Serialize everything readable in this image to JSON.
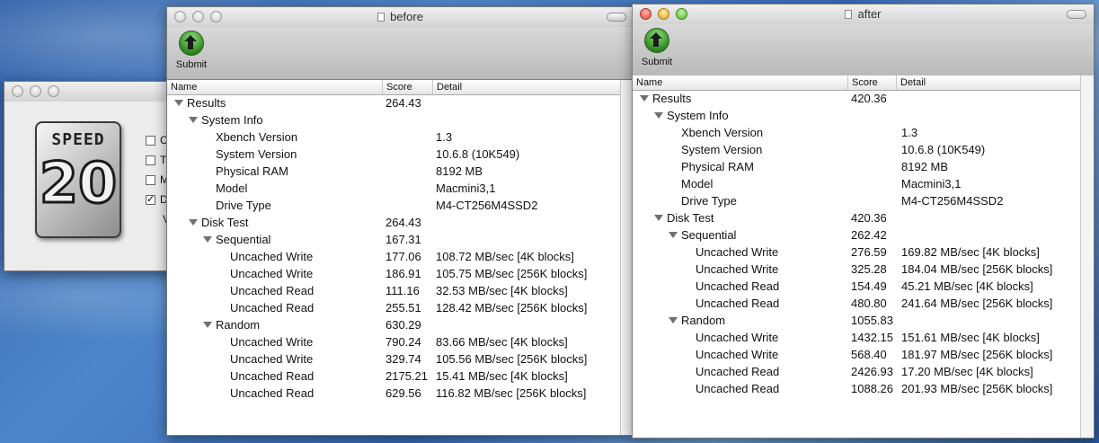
{
  "speed_window": {
    "badge_top": "SPEED",
    "badge_number": "20",
    "checkboxes": [
      {
        "label": "C",
        "checked": false
      },
      {
        "label": "T",
        "checked": false
      },
      {
        "label": "M",
        "checked": false
      },
      {
        "label": "D",
        "checked": true
      }
    ],
    "trailing_label": "V"
  },
  "before_window": {
    "title": "before",
    "submit_label": "Submit",
    "columns": [
      "Name",
      "Score",
      "Detail"
    ],
    "rows": [
      {
        "indent": 0,
        "disclosure": true,
        "name": "Results",
        "score": "264.43",
        "detail": ""
      },
      {
        "indent": 1,
        "disclosure": true,
        "name": "System Info",
        "score": "",
        "detail": ""
      },
      {
        "indent": 2,
        "disclosure": false,
        "name": "Xbench Version",
        "score": "",
        "detail": "1.3"
      },
      {
        "indent": 2,
        "disclosure": false,
        "name": "System Version",
        "score": "",
        "detail": "10.6.8 (10K549)"
      },
      {
        "indent": 2,
        "disclosure": false,
        "name": "Physical RAM",
        "score": "",
        "detail": "8192 MB"
      },
      {
        "indent": 2,
        "disclosure": false,
        "name": "Model",
        "score": "",
        "detail": "Macmini3,1"
      },
      {
        "indent": 2,
        "disclosure": false,
        "name": "Drive Type",
        "score": "",
        "detail": "M4-CT256M4SSD2"
      },
      {
        "indent": 1,
        "disclosure": true,
        "name": "Disk Test",
        "score": "264.43",
        "detail": ""
      },
      {
        "indent": 2,
        "disclosure": true,
        "name": "Sequential",
        "score": "167.31",
        "detail": ""
      },
      {
        "indent": 3,
        "disclosure": false,
        "name": "Uncached Write",
        "score": "177.06",
        "detail": "108.72 MB/sec [4K blocks]"
      },
      {
        "indent": 3,
        "disclosure": false,
        "name": "Uncached Write",
        "score": "186.91",
        "detail": "105.75 MB/sec [256K blocks]"
      },
      {
        "indent": 3,
        "disclosure": false,
        "name": "Uncached Read",
        "score": "111.16",
        "detail": "32.53 MB/sec [4K blocks]"
      },
      {
        "indent": 3,
        "disclosure": false,
        "name": "Uncached Read",
        "score": "255.51",
        "detail": "128.42 MB/sec [256K blocks]"
      },
      {
        "indent": 2,
        "disclosure": true,
        "name": "Random",
        "score": "630.29",
        "detail": ""
      },
      {
        "indent": 3,
        "disclosure": false,
        "name": "Uncached Write",
        "score": "790.24",
        "detail": "83.66 MB/sec [4K blocks]"
      },
      {
        "indent": 3,
        "disclosure": false,
        "name": "Uncached Write",
        "score": "329.74",
        "detail": "105.56 MB/sec [256K blocks]"
      },
      {
        "indent": 3,
        "disclosure": false,
        "name": "Uncached Read",
        "score": "2175.21",
        "detail": "15.41 MB/sec [4K blocks]"
      },
      {
        "indent": 3,
        "disclosure": false,
        "name": "Uncached Read",
        "score": "629.56",
        "detail": "116.82 MB/sec [256K blocks]"
      }
    ]
  },
  "after_window": {
    "title": "after",
    "submit_label": "Submit",
    "columns": [
      "Name",
      "Score",
      "Detail"
    ],
    "rows": [
      {
        "indent": 0,
        "disclosure": true,
        "name": "Results",
        "score": "420.36",
        "detail": ""
      },
      {
        "indent": 1,
        "disclosure": true,
        "name": "System Info",
        "score": "",
        "detail": ""
      },
      {
        "indent": 2,
        "disclosure": false,
        "name": "Xbench Version",
        "score": "",
        "detail": "1.3"
      },
      {
        "indent": 2,
        "disclosure": false,
        "name": "System Version",
        "score": "",
        "detail": "10.6.8 (10K549)"
      },
      {
        "indent": 2,
        "disclosure": false,
        "name": "Physical RAM",
        "score": "",
        "detail": "8192 MB"
      },
      {
        "indent": 2,
        "disclosure": false,
        "name": "Model",
        "score": "",
        "detail": "Macmini3,1"
      },
      {
        "indent": 2,
        "disclosure": false,
        "name": "Drive Type",
        "score": "",
        "detail": "M4-CT256M4SSD2"
      },
      {
        "indent": 1,
        "disclosure": true,
        "name": "Disk Test",
        "score": "420.36",
        "detail": ""
      },
      {
        "indent": 2,
        "disclosure": true,
        "name": "Sequential",
        "score": "262.42",
        "detail": ""
      },
      {
        "indent": 3,
        "disclosure": false,
        "name": "Uncached Write",
        "score": "276.59",
        "detail": "169.82 MB/sec [4K blocks]"
      },
      {
        "indent": 3,
        "disclosure": false,
        "name": "Uncached Write",
        "score": "325.28",
        "detail": "184.04 MB/sec [256K blocks]"
      },
      {
        "indent": 3,
        "disclosure": false,
        "name": "Uncached Read",
        "score": "154.49",
        "detail": "45.21 MB/sec [4K blocks]"
      },
      {
        "indent": 3,
        "disclosure": false,
        "name": "Uncached Read",
        "score": "480.80",
        "detail": "241.64 MB/sec [256K blocks]"
      },
      {
        "indent": 2,
        "disclosure": true,
        "name": "Random",
        "score": "1055.83",
        "detail": ""
      },
      {
        "indent": 3,
        "disclosure": false,
        "name": "Uncached Write",
        "score": "1432.15",
        "detail": "151.61 MB/sec [4K blocks]"
      },
      {
        "indent": 3,
        "disclosure": false,
        "name": "Uncached Write",
        "score": "568.40",
        "detail": "181.97 MB/sec [256K blocks]"
      },
      {
        "indent": 3,
        "disclosure": false,
        "name": "Uncached Read",
        "score": "2426.93",
        "detail": "17.20 MB/sec [4K blocks]"
      },
      {
        "indent": 3,
        "disclosure": false,
        "name": "Uncached Read",
        "score": "1088.26",
        "detail": "201.93 MB/sec [256K blocks]"
      }
    ]
  }
}
